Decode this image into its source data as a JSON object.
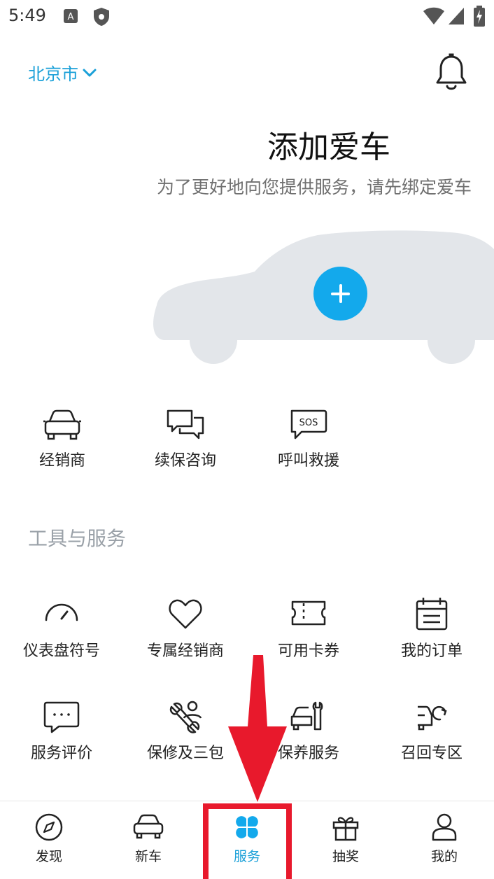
{
  "status_bar": {
    "time": "5:49"
  },
  "header": {
    "city": "北京市"
  },
  "add_car": {
    "title": "添加爱车",
    "subtitle": "为了更好地向您提供服务，请先绑定爱车"
  },
  "quick_actions": [
    {
      "label": "经销商",
      "icon": "car-front-icon"
    },
    {
      "label": "续保咨询",
      "icon": "chat-bubbles-icon"
    },
    {
      "label": "呼叫救援",
      "icon": "sos-icon"
    }
  ],
  "tools": {
    "title": "工具与服务",
    "items": [
      {
        "label": "仪表盘符号",
        "icon": "gauge-icon"
      },
      {
        "label": "专属经销商",
        "icon": "heart-icon"
      },
      {
        "label": "可用卡券",
        "icon": "ticket-icon"
      },
      {
        "label": "我的订单",
        "icon": "calendar-list-icon"
      },
      {
        "label": "服务评价",
        "icon": "comment-dots-icon"
      },
      {
        "label": "保修及三包",
        "icon": "wrench-person-icon"
      },
      {
        "label": "保养服务",
        "icon": "car-wrench-icon"
      },
      {
        "label": "召回专区",
        "icon": "recall-icon"
      }
    ]
  },
  "tabbar": {
    "items": [
      {
        "label": "发现",
        "icon": "compass-icon"
      },
      {
        "label": "新车",
        "icon": "car-icon"
      },
      {
        "label": "服务",
        "icon": "four-petal-icon",
        "active": true
      },
      {
        "label": "抽奖",
        "icon": "gift-icon"
      },
      {
        "label": "我的",
        "icon": "user-icon"
      }
    ]
  },
  "colors": {
    "accent": "#1aa0d8",
    "plus_button": "#13a9ec",
    "car_silhouette": "#e3e6ea",
    "annotation_red": "#e8192c",
    "section_title": "#9aa1a8"
  }
}
